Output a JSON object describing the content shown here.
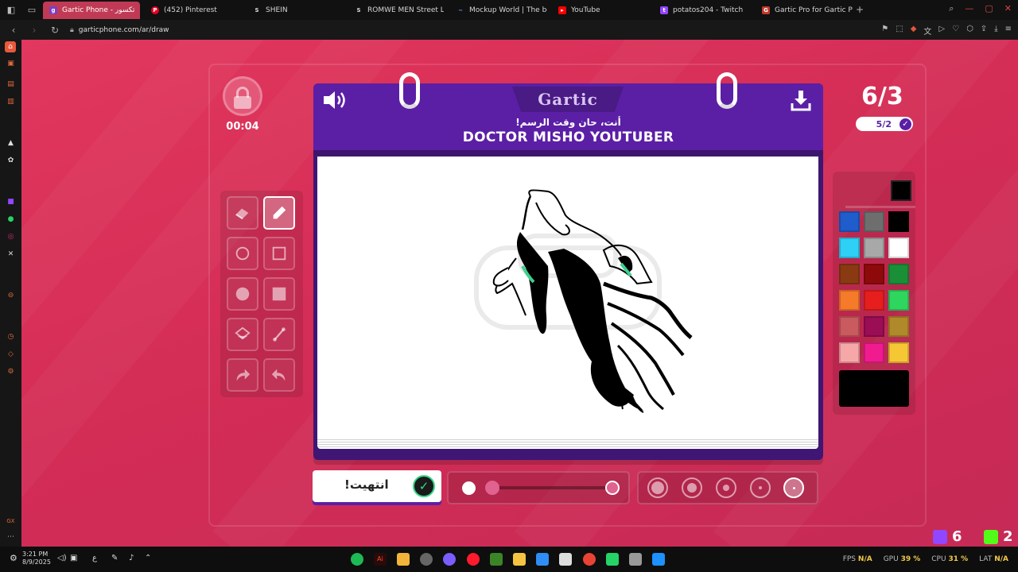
{
  "browser": {
    "tabs": [
      {
        "title": "Gartic Phone - تكسور",
        "active": true
      },
      {
        "title": "(452) Pinterest"
      },
      {
        "title": "SHEIN"
      },
      {
        "title": "ROMWE MEN Street Life"
      },
      {
        "title": "Mockup World | The best"
      },
      {
        "title": "YouTube"
      },
      {
        "title": "potatos204 - Twitch"
      },
      {
        "title": "Gartic Pro for Gartic Phon"
      }
    ],
    "url": "garticphone.com/ar/draw"
  },
  "game": {
    "logo": "Gartic",
    "timer": "00:04",
    "round": "6/3",
    "players_done": "5/2",
    "prompt_instruction": "أنت، حان وقت الرسم!",
    "prompt_word": "DOCTOR MISHO YOUTUBER",
    "done_button": "انتهيت!",
    "tools": [
      "eraser",
      "pen",
      "ellipse",
      "rectangle",
      "filled-ellipse",
      "filled-rectangle",
      "fill-bucket",
      "line",
      "redo",
      "undo"
    ],
    "active_tool": "pen",
    "current_color": "#000000",
    "palette": [
      [
        "#1f5ccc",
        "#6e6e6e",
        "#000000"
      ],
      [
        "#2ed0f5",
        "#a8a8a8",
        "#ffffff"
      ],
      [
        "#8a3a12",
        "#8e0a0a",
        "#1a8f37"
      ],
      [
        "#f57a2a",
        "#e61e1e",
        "#2fd65e"
      ],
      [
        "#c95a5e",
        "#9b0d55",
        "#b08a2a"
      ],
      [
        "#f6a8a8",
        "#f01b8e",
        "#f6c735"
      ]
    ],
    "brush_size_level": 0.0,
    "opacity_levels": 5,
    "active_opacity": 5
  },
  "overlay": {
    "twitch_count": "6",
    "kick_count": "2"
  },
  "taskbar": {
    "time": "3:21 PM",
    "date": "8/9/2025",
    "lang": "ع",
    "fps_label": "FPS",
    "fps_value": "N/A",
    "gpu_label": "GPU",
    "gpu_value": "39 %",
    "cpu_label": "CPU",
    "cpu_value": "31 %",
    "lat_label": "LAT",
    "lat_value": "N/A"
  },
  "colors": {
    "accent_purple": "#5b1fa5",
    "page_red": "#d42d56"
  }
}
